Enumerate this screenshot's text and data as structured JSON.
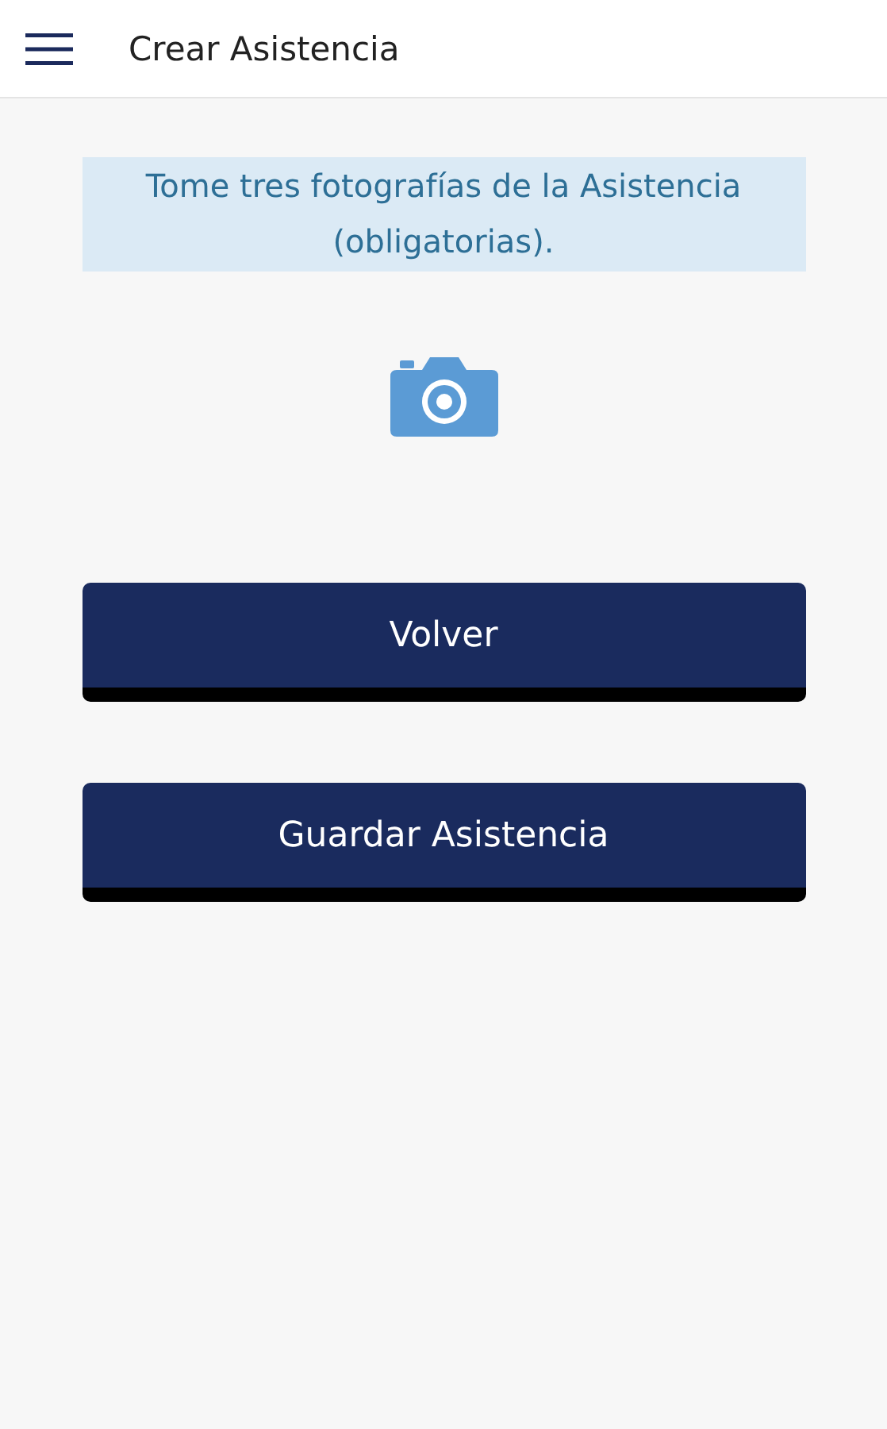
{
  "header": {
    "title": "Crear Asistencia"
  },
  "notice": {
    "text": "Tome tres fotografías de la Asistencia (obligatorias)."
  },
  "buttons": [
    {
      "label": "Volver"
    },
    {
      "label": "Guardar Asistencia"
    }
  ]
}
